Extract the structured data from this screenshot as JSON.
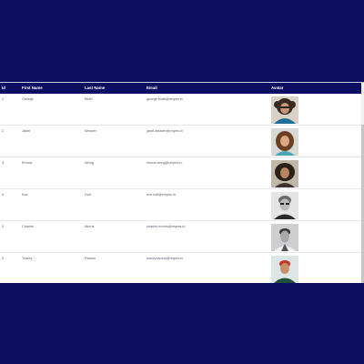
{
  "colors": {
    "page_background": "#0c0f61",
    "header_background": "#0c0f61",
    "header_text": "#ffffff",
    "cell_text": "#555a66"
  },
  "table": {
    "columns": [
      "Id",
      "First Name",
      "Last Name",
      "Email",
      "Avatar"
    ],
    "rows": [
      {
        "id": "1",
        "first_name": "George",
        "last_name": "Bluth",
        "email": "george.bluth@reqres.in",
        "avatar": "avatar-george-bluth"
      },
      {
        "id": "2",
        "first_name": "Janet",
        "last_name": "Weaver",
        "email": "janet.weaver@reqres.in",
        "avatar": "avatar-janet-weaver"
      },
      {
        "id": "3",
        "first_name": "Emma",
        "last_name": "Wong",
        "email": "emma.wong@reqres.in",
        "avatar": "avatar-emma-wong"
      },
      {
        "id": "4",
        "first_name": "Eve",
        "last_name": "Holt",
        "email": "eve.holt@reqres.in",
        "avatar": "avatar-eve-holt"
      },
      {
        "id": "5",
        "first_name": "Charles",
        "last_name": "Morris",
        "email": "charles.morris@reqres.in",
        "avatar": "avatar-charles-morris"
      },
      {
        "id": "6",
        "first_name": "Tracey",
        "last_name": "Ramos",
        "email": "tracey.ramos@reqres.in",
        "avatar": "avatar-tracey-ramos"
      }
    ]
  }
}
